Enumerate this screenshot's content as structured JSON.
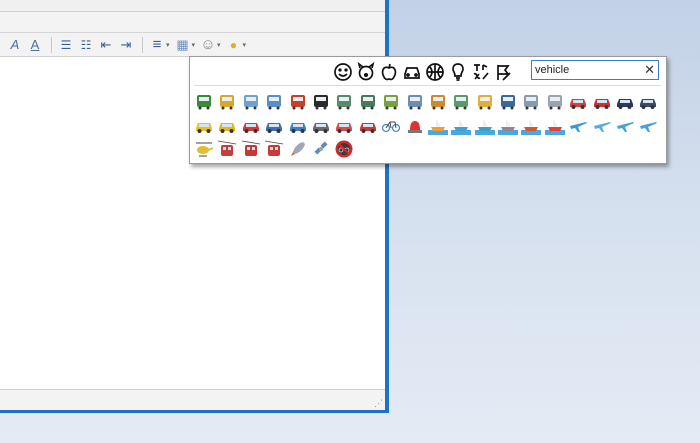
{
  "toolbar": {
    "items": [
      "italic-a-icon",
      "font-color-a-icon",
      "sep",
      "bullet-list-icon",
      "numbered-list-icon",
      "outdent-icon",
      "indent-icon",
      "sep",
      "align-icon",
      "arrow",
      "table-icon",
      "arrow",
      "smiley-icon",
      "arrow",
      "emoji-icon",
      "arrow"
    ]
  },
  "emoji_picker": {
    "categories": [
      "smileys-icon",
      "animals-icon",
      "food-icon",
      "travel-icon",
      "activities-icon",
      "objects-icon",
      "symbols-icon",
      "flags-icon"
    ],
    "search": {
      "value": "vehicle",
      "placeholder": "",
      "clear_glyph": "✕"
    },
    "rows": [
      [
        {
          "name": "locomotive",
          "c": "#3a8a3a"
        },
        {
          "name": "railway-car",
          "c": "#d9a82b"
        },
        {
          "name": "high-speed-train",
          "c": "#6ea0d0"
        },
        {
          "name": "bullet-train",
          "c": "#5a8fc4"
        },
        {
          "name": "metro",
          "c": "#c8402a"
        },
        {
          "name": "station-train",
          "c": "#2a2a2a"
        },
        {
          "name": "light-rail",
          "c": "#5a8a6a"
        },
        {
          "name": "tram",
          "c": "#4a7a5a"
        },
        {
          "name": "monorail",
          "c": "#7aa040"
        },
        {
          "name": "mountain-railway",
          "c": "#6a90b0"
        },
        {
          "name": "train",
          "c": "#d08a2a"
        },
        {
          "name": "tram-car",
          "c": "#5a9a6a"
        },
        {
          "name": "bus",
          "c": "#e0b030"
        },
        {
          "name": "oncoming-bus",
          "c": "#3a6a9a"
        },
        {
          "name": "trolleybus",
          "c": "#8a9aa8"
        },
        {
          "name": "minibus",
          "c": "#9aa4ae"
        },
        {
          "name": "ambulance",
          "c": "#d04040"
        },
        {
          "name": "fire-engine",
          "c": "#d03030"
        },
        {
          "name": "police-car",
          "c": "#2a3a5a"
        },
        {
          "name": "oncoming-police-car",
          "c": "#3a4a6a"
        }
      ],
      [
        {
          "name": "taxi",
          "c": "#e8c020"
        },
        {
          "name": "oncoming-taxi",
          "c": "#e0b818"
        },
        {
          "name": "automobile",
          "c": "#d03a3a"
        },
        {
          "name": "oncoming-automobile",
          "c": "#3a70b0"
        },
        {
          "name": "blue-car",
          "c": "#3a80c8"
        },
        {
          "name": "delivery-truck",
          "c": "#6a6a6a"
        },
        {
          "name": "articulated-lorry",
          "c": "#d05050"
        },
        {
          "name": "tractor",
          "c": "#c83a3a"
        },
        {
          "name": "bicycle",
          "c": "#4a8ac8"
        },
        {
          "name": "rotating-light",
          "c": "#e03030"
        },
        {
          "name": "boat",
          "c": "#f0a030"
        },
        {
          "name": "sailboat",
          "c": "#40a0d0"
        },
        {
          "name": "speedboat",
          "c": "#3aa0c8"
        },
        {
          "name": "passenger-ship",
          "c": "#8a8a9a"
        },
        {
          "name": "ferry",
          "c": "#d05a30"
        },
        {
          "name": "motor-boat",
          "c": "#e04040"
        },
        {
          "name": "airplane",
          "c": "#3a9ad8"
        },
        {
          "name": "small-airplane",
          "c": "#5aaadd"
        },
        {
          "name": "airplane-departure",
          "c": "#4aa0d8"
        },
        {
          "name": "airplane-arrival",
          "c": "#4aa0d8"
        }
      ],
      [
        {
          "name": "helicopter",
          "c": "#e0c030"
        },
        {
          "name": "suspension-railway",
          "c": "#c04040"
        },
        {
          "name": "mountain-cableway",
          "c": "#c03a3a"
        },
        {
          "name": "aerial-tramway",
          "c": "#c83a3a"
        },
        {
          "name": "rocket",
          "c": "#a0a8b8"
        },
        {
          "name": "satellite",
          "c": "#5a8ac8"
        },
        {
          "name": "no-bicycles",
          "c": "#d02a2a"
        }
      ]
    ]
  }
}
